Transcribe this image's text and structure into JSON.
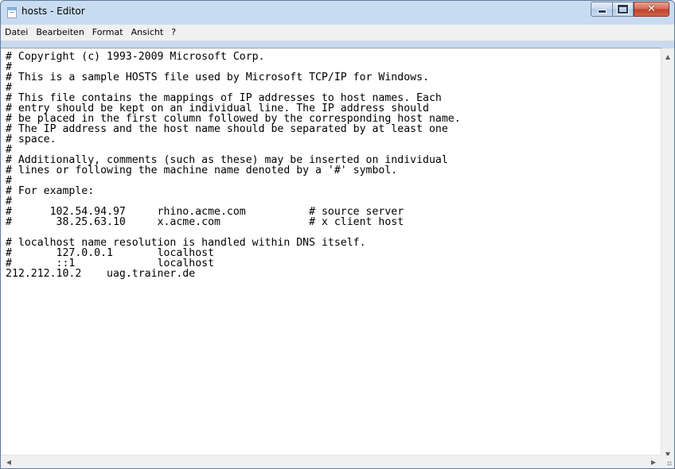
{
  "window": {
    "title": "hosts - Editor",
    "icon": "notepad-icon",
    "controls": {
      "minimize_icon": "minimize-icon",
      "maximize_icon": "maximize-icon",
      "close_glyph": "✕"
    }
  },
  "menu": {
    "items": [
      "Datei",
      "Bearbeiten",
      "Format",
      "Ansicht",
      "?"
    ]
  },
  "editor": {
    "content": "# Copyright (c) 1993-2009 Microsoft Corp.\n#\n# This is a sample HOSTS file used by Microsoft TCP/IP for Windows.\n#\n# This file contains the mappings of IP addresses to host names. Each\n# entry should be kept on an individual line. The IP address should\n# be placed in the first column followed by the corresponding host name.\n# The IP address and the host name should be separated by at least one\n# space.\n#\n# Additionally, comments (such as these) may be inserted on individual\n# lines or following the machine name denoted by a '#' symbol.\n#\n# For example:\n#\n#      102.54.94.97     rhino.acme.com          # source server\n#       38.25.63.10     x.acme.com              # x client host\n\n# localhost name resolution is handled within DNS itself.\n#\t127.0.0.1       localhost\n#\t::1             localhost\n212.212.10.2    uag.trainer.de"
  },
  "scrollbars": {
    "up_glyph": "▲",
    "down_glyph": "▼",
    "left_glyph": "◀",
    "right_glyph": "▶"
  }
}
